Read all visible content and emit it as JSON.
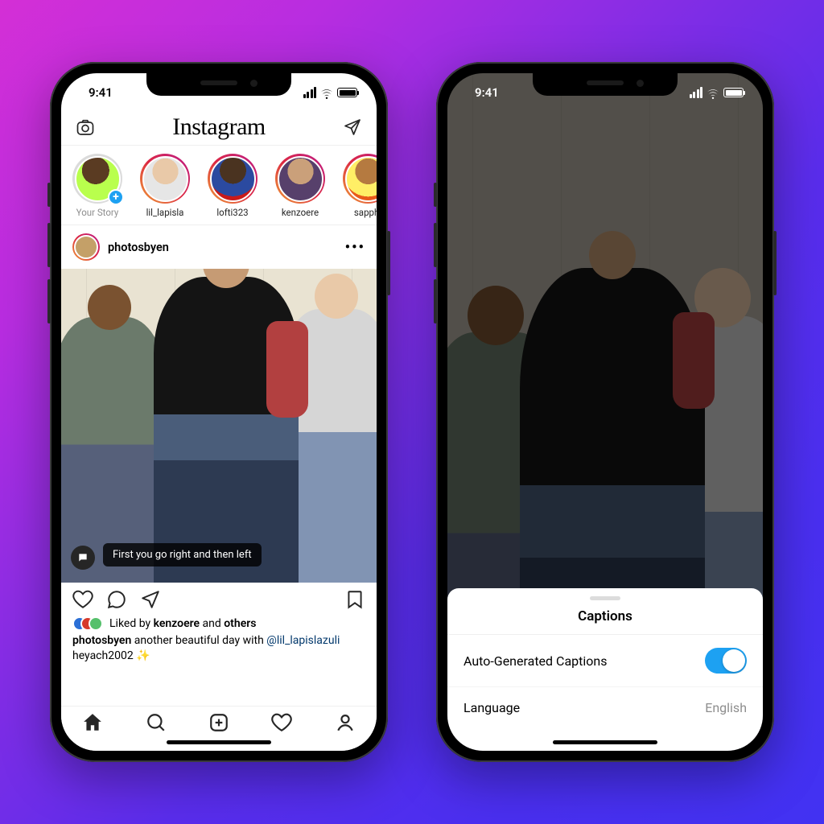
{
  "status_bar": {
    "time": "9:41"
  },
  "header": {
    "logo": "Instagram"
  },
  "stories": {
    "items": [
      {
        "label": "Your Story",
        "is_you": true
      },
      {
        "label": "lil_lapisla"
      },
      {
        "label": "lofti323"
      },
      {
        "label": "kenzoere"
      },
      {
        "label": "sapphi"
      }
    ]
  },
  "post": {
    "author": "photosbyen",
    "caption_overlay": "First you go right and then left",
    "likes_text_prefix": "Liked by ",
    "likes_user": "kenzoere",
    "likes_text_middle": " and ",
    "likes_text_others": "others",
    "caption_user": "photosbyen",
    "caption_body": " another beautiful day with ",
    "caption_mention": "@lil_lapislazuli",
    "caption_line2": "heyach2002 ✨"
  },
  "sheet": {
    "title": "Captions",
    "row1_label": "Auto-Generated Captions",
    "row1_on": true,
    "row2_label": "Language",
    "row2_value": "English"
  }
}
